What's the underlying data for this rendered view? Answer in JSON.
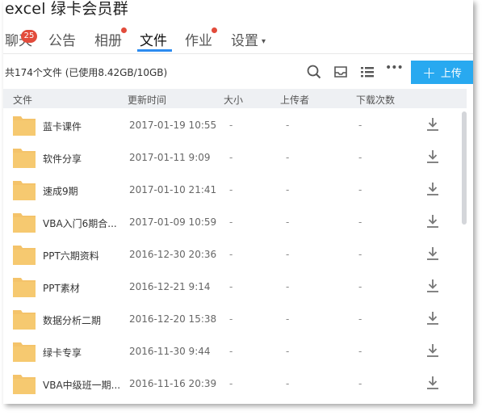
{
  "window": {
    "title": "excel 绿卡会员群"
  },
  "tabs": [
    {
      "label": "聊天",
      "badge": "25"
    },
    {
      "label": "公告"
    },
    {
      "label": "相册"
    },
    {
      "label": "文件",
      "active": true
    },
    {
      "label": "作业"
    },
    {
      "label": "设置",
      "caret": "▾"
    }
  ],
  "toolbar": {
    "file_count": "共174个文件 (已使用8.42GB/10GB)",
    "icons": [
      "search-icon",
      "inbox-icon",
      "list-view-icon",
      "more-icon"
    ],
    "more": "•••",
    "upload_label": "上传",
    "upload_plus": "+"
  },
  "table": {
    "headers": {
      "name": "文件",
      "time": "更新时间",
      "size": "大小",
      "uploader": "上传者",
      "downloads": "下载次数"
    },
    "rows": [
      {
        "name": "蓝卡课件",
        "time": "2017-01-19 10:55",
        "size": "-",
        "uploader": "-",
        "downloads": "-"
      },
      {
        "name": "软件分享",
        "time": "2017-01-11 9:09",
        "size": "-",
        "uploader": "-",
        "downloads": "-"
      },
      {
        "name": "速成9期",
        "time": "2017-01-10 21:41",
        "size": "-",
        "uploader": "-",
        "downloads": "-"
      },
      {
        "name": "VBA入门6期合...",
        "time": "2017-01-09 10:59",
        "size": "-",
        "uploader": "-",
        "downloads": "-"
      },
      {
        "name": "PPT六期资料",
        "time": "2016-12-30 20:36",
        "size": "-",
        "uploader": "-",
        "downloads": "-"
      },
      {
        "name": "PPT素材",
        "time": "2016-12-21 9:14",
        "size": "-",
        "uploader": "-",
        "downloads": "-"
      },
      {
        "name": "数据分析二期",
        "time": "2016-12-20 15:38",
        "size": "-",
        "uploader": "-",
        "downloads": "-"
      },
      {
        "name": "绿卡专享",
        "time": "2016-11-30 9:44",
        "size": "-",
        "uploader": "-",
        "downloads": "-"
      },
      {
        "name": "VBA中级班一期...",
        "time": "2016-11-16 20:39",
        "size": "-",
        "uploader": "-",
        "downloads": "-"
      }
    ]
  },
  "colors": {
    "accent": "#28a9f0",
    "tab_underline": "#2d8cf0",
    "badge": "#e24b3b",
    "folder": "#f4c36a",
    "header_bg": "#eef0f3"
  }
}
